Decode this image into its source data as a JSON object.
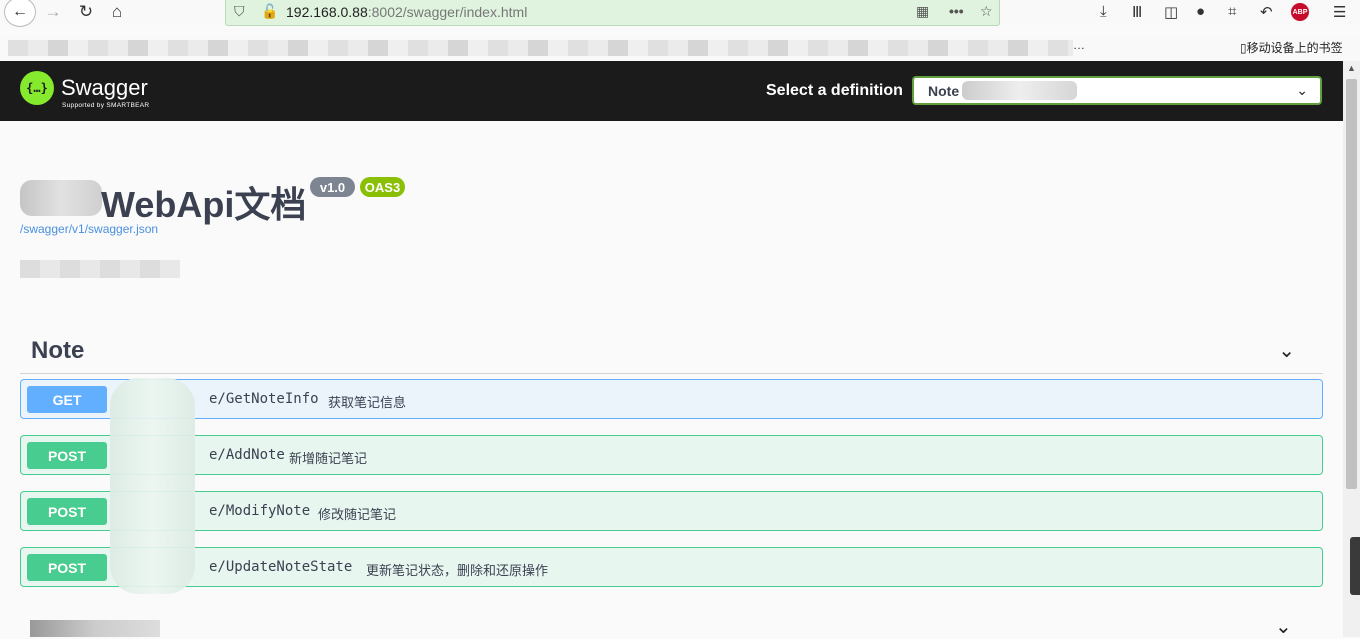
{
  "browser": {
    "url_host": "192.168.0.88",
    "url_port": ":8002",
    "url_path": "/swagger/index.html",
    "bookmark_more": "…",
    "mobile_bookmarks": "移动设备上的书签",
    "abp_label": "ABP"
  },
  "swagger": {
    "logo_text": "Swagger",
    "logo_symbol": "{…}",
    "logo_sub": "Supported by SMARTBEAR",
    "definition_label": "Select a definition",
    "definition_value": "Note"
  },
  "info": {
    "title": "WebApi文档",
    "version": "v1.0",
    "oas": "OAS3",
    "spec_url": "/swagger/v1/swagger.json"
  },
  "tag": {
    "name": "Note",
    "operations": [
      {
        "method": "GET",
        "path": "e/GetNoteInfo",
        "summary": "获取笔记信息"
      },
      {
        "method": "POST",
        "path": "e/AddNote",
        "summary": "新增随记笔记"
      },
      {
        "method": "POST",
        "path": "e/ModifyNote",
        "summary": "修改随记笔记"
      },
      {
        "method": "POST",
        "path": "e/UpdateNoteState",
        "summary": "更新笔记状态，删除和还原操作"
      }
    ]
  },
  "colors": {
    "get": "#61affe",
    "post": "#49cc90",
    "topbar": "#1b1b1b",
    "logo": "#85ea2d"
  }
}
